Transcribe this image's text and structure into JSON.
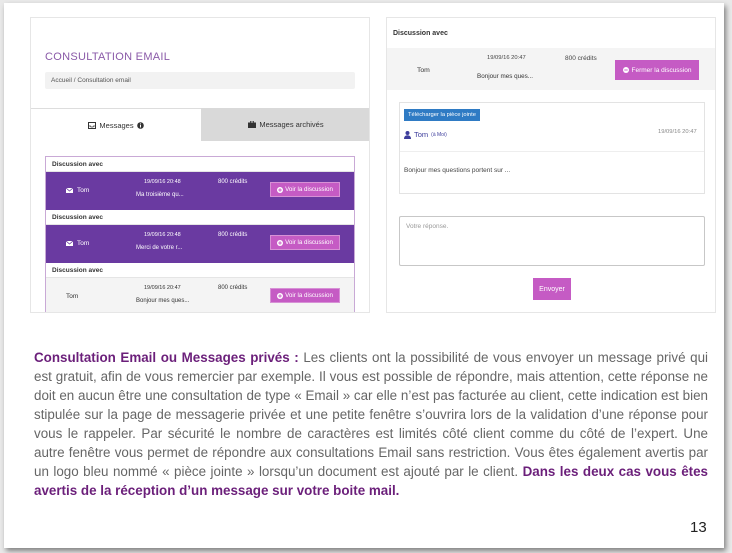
{
  "left_panel": {
    "title": "CONSULTATION EMAIL",
    "breadcrumb": "Accueil / Consultation email",
    "tabs": [
      {
        "label": "Messages"
      },
      {
        "label": "Messages archivés"
      }
    ],
    "discussions": [
      {
        "header": "Discussion avec",
        "name": "Tom",
        "date": "19/09/16 20:48",
        "preview": "Ma troisième qu...",
        "credits": "800 crédits",
        "button": "Voir la discussion"
      },
      {
        "header": "Discussion avec",
        "name": "Tom",
        "date": "19/09/16 20:48",
        "preview": "Merci de votre r...",
        "credits": "800 crédits",
        "button": "Voir la discussion"
      },
      {
        "header": "Discussion avec",
        "name": "Tom",
        "date": "19/09/16 20:47",
        "preview": "Bonjour mes ques...",
        "credits": "800 crédits",
        "button": "Voir la discussion"
      }
    ]
  },
  "right_panel": {
    "header": "Discussion avec",
    "date": "19/09/16 20:47",
    "credits": "800 crédits",
    "name": "Tom",
    "preview": "Bonjour mes ques...",
    "close_button": "Fermer la discussion",
    "attachment_label": "Télécharger la pièce jointe",
    "author": "Tom",
    "author_suffix": "(à Moi)",
    "message_date": "19/09/16 20:47",
    "message_text": "Bonjour mes questions portent sur ...",
    "reply_placeholder": "Votre réponse.",
    "send_button": "Envoyer"
  },
  "paragraph": {
    "lead": "Consultation Email ou Messages privés :",
    "body": " Les clients ont la possibilité de vous envoyer un message privé qui est gratuit, afin de vous remercier par exemple. Il vous est possible de répondre, mais attention, cette réponse ne doit en aucun être une consultation de type «  Email » car elle n’est pas facturée au client, cette indication est bien stipulée sur la page de messagerie privée et une petite fenêtre s’ouvrira lors de la validation d’une réponse pour vous le rappeler. Par sécurité le nombre de caractères est limités côté client comme du côté de l’expert. Une autre fenêtre vous permet de répondre aux consultations Email sans restriction. Vous êtes également avertis par un logo bleu nommé « pièce jointe » lorsqu’un document est ajouté par le client.",
    "closing": " Dans les deux cas vous êtes avertis de la réception d’un message sur votre boite mail."
  },
  "page_number": "13",
  "colors": {
    "accent_purple": "#6a3aa1",
    "button_pink": "#c55bc4",
    "attachment_blue": "#2f7bc4",
    "highlight_text": "#6b1f7a"
  }
}
